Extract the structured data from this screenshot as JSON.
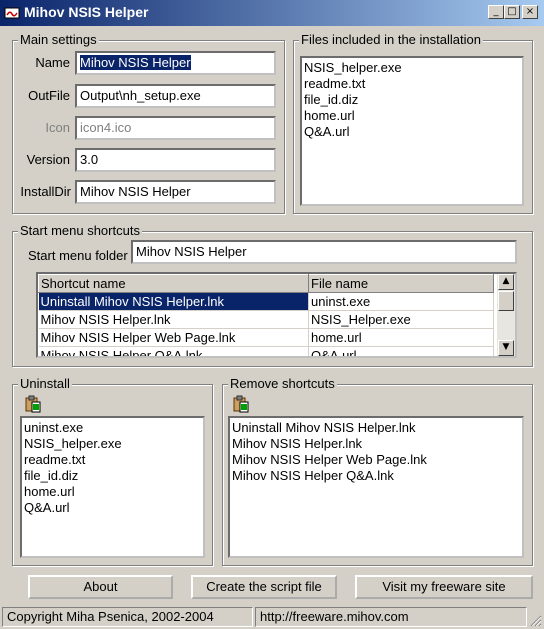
{
  "window": {
    "title": "Mihov NSIS Helper",
    "controls": [
      "_",
      "□",
      "×"
    ]
  },
  "main_settings": {
    "group_label": "Main settings",
    "fields": [
      {
        "label": "Name",
        "value": "Mihov NSIS Helper"
      },
      {
        "label": "OutFile",
        "value": "Output\\nh_setup.exe"
      },
      {
        "label": "Icon",
        "value": "icon4.ico"
      },
      {
        "label": "Version",
        "value": "3.0"
      },
      {
        "label": "InstallDir",
        "value": "Mihov NSIS Helper"
      }
    ]
  },
  "files": {
    "group_label": "Files included in the installation",
    "items": [
      "NSIS_helper.exe",
      "readme.txt",
      "file_id.diz",
      "home.url",
      "Q&A.url"
    ]
  },
  "start_menu": {
    "group_label": "Start menu shortcuts",
    "folder_label": "Start menu folder",
    "folder_value": "Mihov NSIS Helper",
    "columns": [
      "Shortcut name",
      "File name"
    ],
    "rows": [
      [
        "Uninstall Mihov NSIS Helper.lnk",
        "uninst.exe"
      ],
      [
        "Mihov NSIS Helper.lnk",
        "NSIS_Helper.exe"
      ],
      [
        "Mihov NSIS Helper Web Page.lnk",
        "home.url"
      ],
      [
        "Mihov NSIS Helper Q&A.lnk",
        "Q&A.url"
      ]
    ]
  },
  "uninstall": {
    "group_label": "Uninstall",
    "icon": "clipboard-paste-icon",
    "items": [
      "uninst.exe",
      "NSIS_helper.exe",
      "readme.txt",
      "file_id.diz",
      "home.url",
      "Q&A.url"
    ]
  },
  "remove_shortcuts": {
    "group_label": "Remove shortcuts",
    "icon": "clipboard-paste-icon",
    "items": [
      "Uninstall Mihov NSIS Helper.lnk",
      "Mihov NSIS Helper.lnk",
      "Mihov NSIS Helper Web Page.lnk",
      "Mihov NSIS Helper Q&A.lnk"
    ]
  },
  "buttons": {
    "about": "About",
    "create": "Create the script file",
    "visit": "Visit my freeware site"
  },
  "statusbar": {
    "left": "Copyright Miha Psenica, 2002-2004",
    "right": "http://freeware.mihov.com"
  },
  "colors": {
    "title_start": "#0a246a",
    "title_end": "#a6caf0",
    "selection": "#0a246a",
    "face": "#d4d0c8"
  }
}
